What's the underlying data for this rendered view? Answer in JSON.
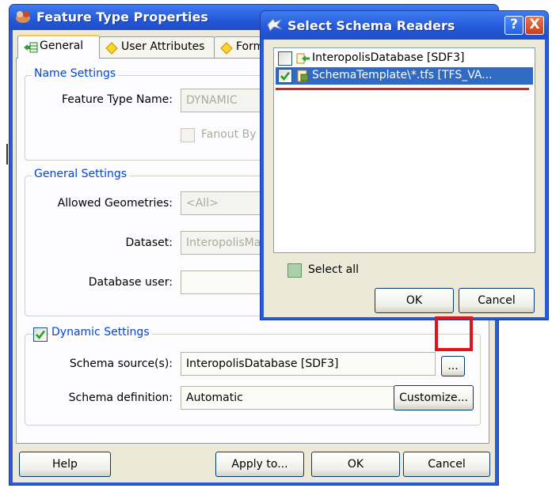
{
  "main_window": {
    "title": "Feature Type Properties",
    "tabs": [
      {
        "label": "General",
        "active": true
      },
      {
        "label": "User Attributes",
        "active": false
      },
      {
        "label": "Form",
        "active": false
      }
    ],
    "name_settings": {
      "title": "Name Settings",
      "feature_type_name_label": "Feature Type Name:",
      "feature_type_name_value": "DYNAMIC",
      "fanout_label": "Fanout By",
      "fanout_checked": false
    },
    "general_settings": {
      "title": "General Settings",
      "allowed_geometries_label": "Allowed Geometries:",
      "allowed_geometries_value": "<All>",
      "dataset_label": "Dataset:",
      "dataset_value": "InteropolisMa",
      "database_user_label": "Database user:",
      "database_user_value": ""
    },
    "dynamic_settings": {
      "title": "Dynamic Settings",
      "checked": true,
      "schema_sources_label": "Schema source(s):",
      "schema_sources_value": "InteropolisDatabase [SDF3]",
      "browse_label": "...",
      "schema_definition_label": "Schema definition:",
      "schema_definition_value": "Automatic",
      "customize_label": "Customize..."
    },
    "buttons": {
      "help": "Help",
      "apply_to": "Apply to...",
      "ok": "OK",
      "cancel": "Cancel"
    }
  },
  "dialog": {
    "title": "Select Schema Readers",
    "help_glyph": "?",
    "close_glyph": "X",
    "items": [
      {
        "label": "InteropolisDatabase [SDF3]",
        "checked": false,
        "selected": false,
        "icon": "reader-arrow-icon"
      },
      {
        "label": "SchemaTemplate\\*.tfs [TFS_VA...",
        "checked": true,
        "selected": true,
        "icon": "reader-template-icon"
      }
    ],
    "select_all_label": "Select all",
    "ok_label": "OK",
    "cancel_label": "Cancel"
  },
  "colors": {
    "titlebar": "#2458d8",
    "group_title": "#0046d5",
    "selection": "#316ac5",
    "highlight_red": "#e2121b"
  }
}
